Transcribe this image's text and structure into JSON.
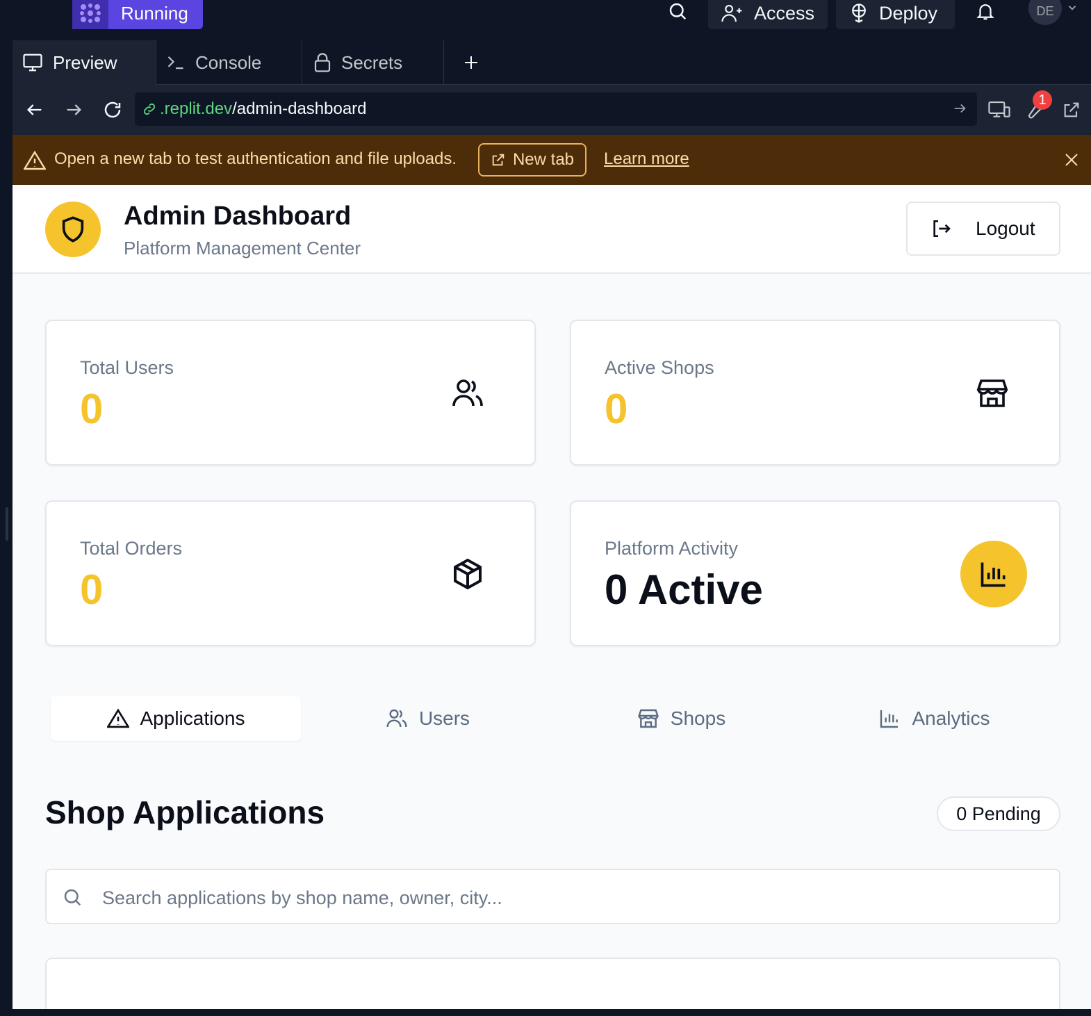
{
  "topbar": {
    "run_label": "Running",
    "access_label": "Access",
    "deploy_label": "Deploy",
    "avatar_initials": "DE"
  },
  "pane_tabs": [
    {
      "label": "Preview"
    },
    {
      "label": "Console"
    },
    {
      "label": "Secrets"
    }
  ],
  "url_bar": {
    "domain": ".replit.dev",
    "path": "/admin-dashboard",
    "devtools_badge": "1"
  },
  "banner": {
    "message": "Open a new tab to test authentication and file uploads.",
    "new_tab_label": "New tab",
    "learn_more_label": "Learn more"
  },
  "header": {
    "title": "Admin Dashboard",
    "subtitle": "Platform Management Center",
    "logout_label": "Logout"
  },
  "stats": [
    {
      "label": "Total Users",
      "value": "0",
      "icon": "users-icon"
    },
    {
      "label": "Active Shops",
      "value": "0",
      "icon": "store-icon"
    },
    {
      "label": "Total Orders",
      "value": "0",
      "icon": "package-icon"
    },
    {
      "label": "Platform Activity",
      "value": "0 Active",
      "icon": "bar-chart-icon"
    }
  ],
  "tabs": [
    {
      "label": "Applications",
      "icon": "alert-triangle-icon",
      "active": true
    },
    {
      "label": "Users",
      "icon": "users-icon",
      "active": false
    },
    {
      "label": "Shops",
      "icon": "store-icon",
      "active": false
    },
    {
      "label": "Analytics",
      "icon": "bar-chart-icon",
      "active": false
    }
  ],
  "section": {
    "title": "Shop Applications",
    "pending_badge": "0 Pending",
    "search_placeholder": "Search applications by shop name, owner, city...",
    "search_value": ""
  },
  "colors": {
    "accent": "#f5c32c",
    "banner_bg": "#4d2d09",
    "ide_bg": "#0e1525",
    "run_purple": "#5b45e0"
  }
}
